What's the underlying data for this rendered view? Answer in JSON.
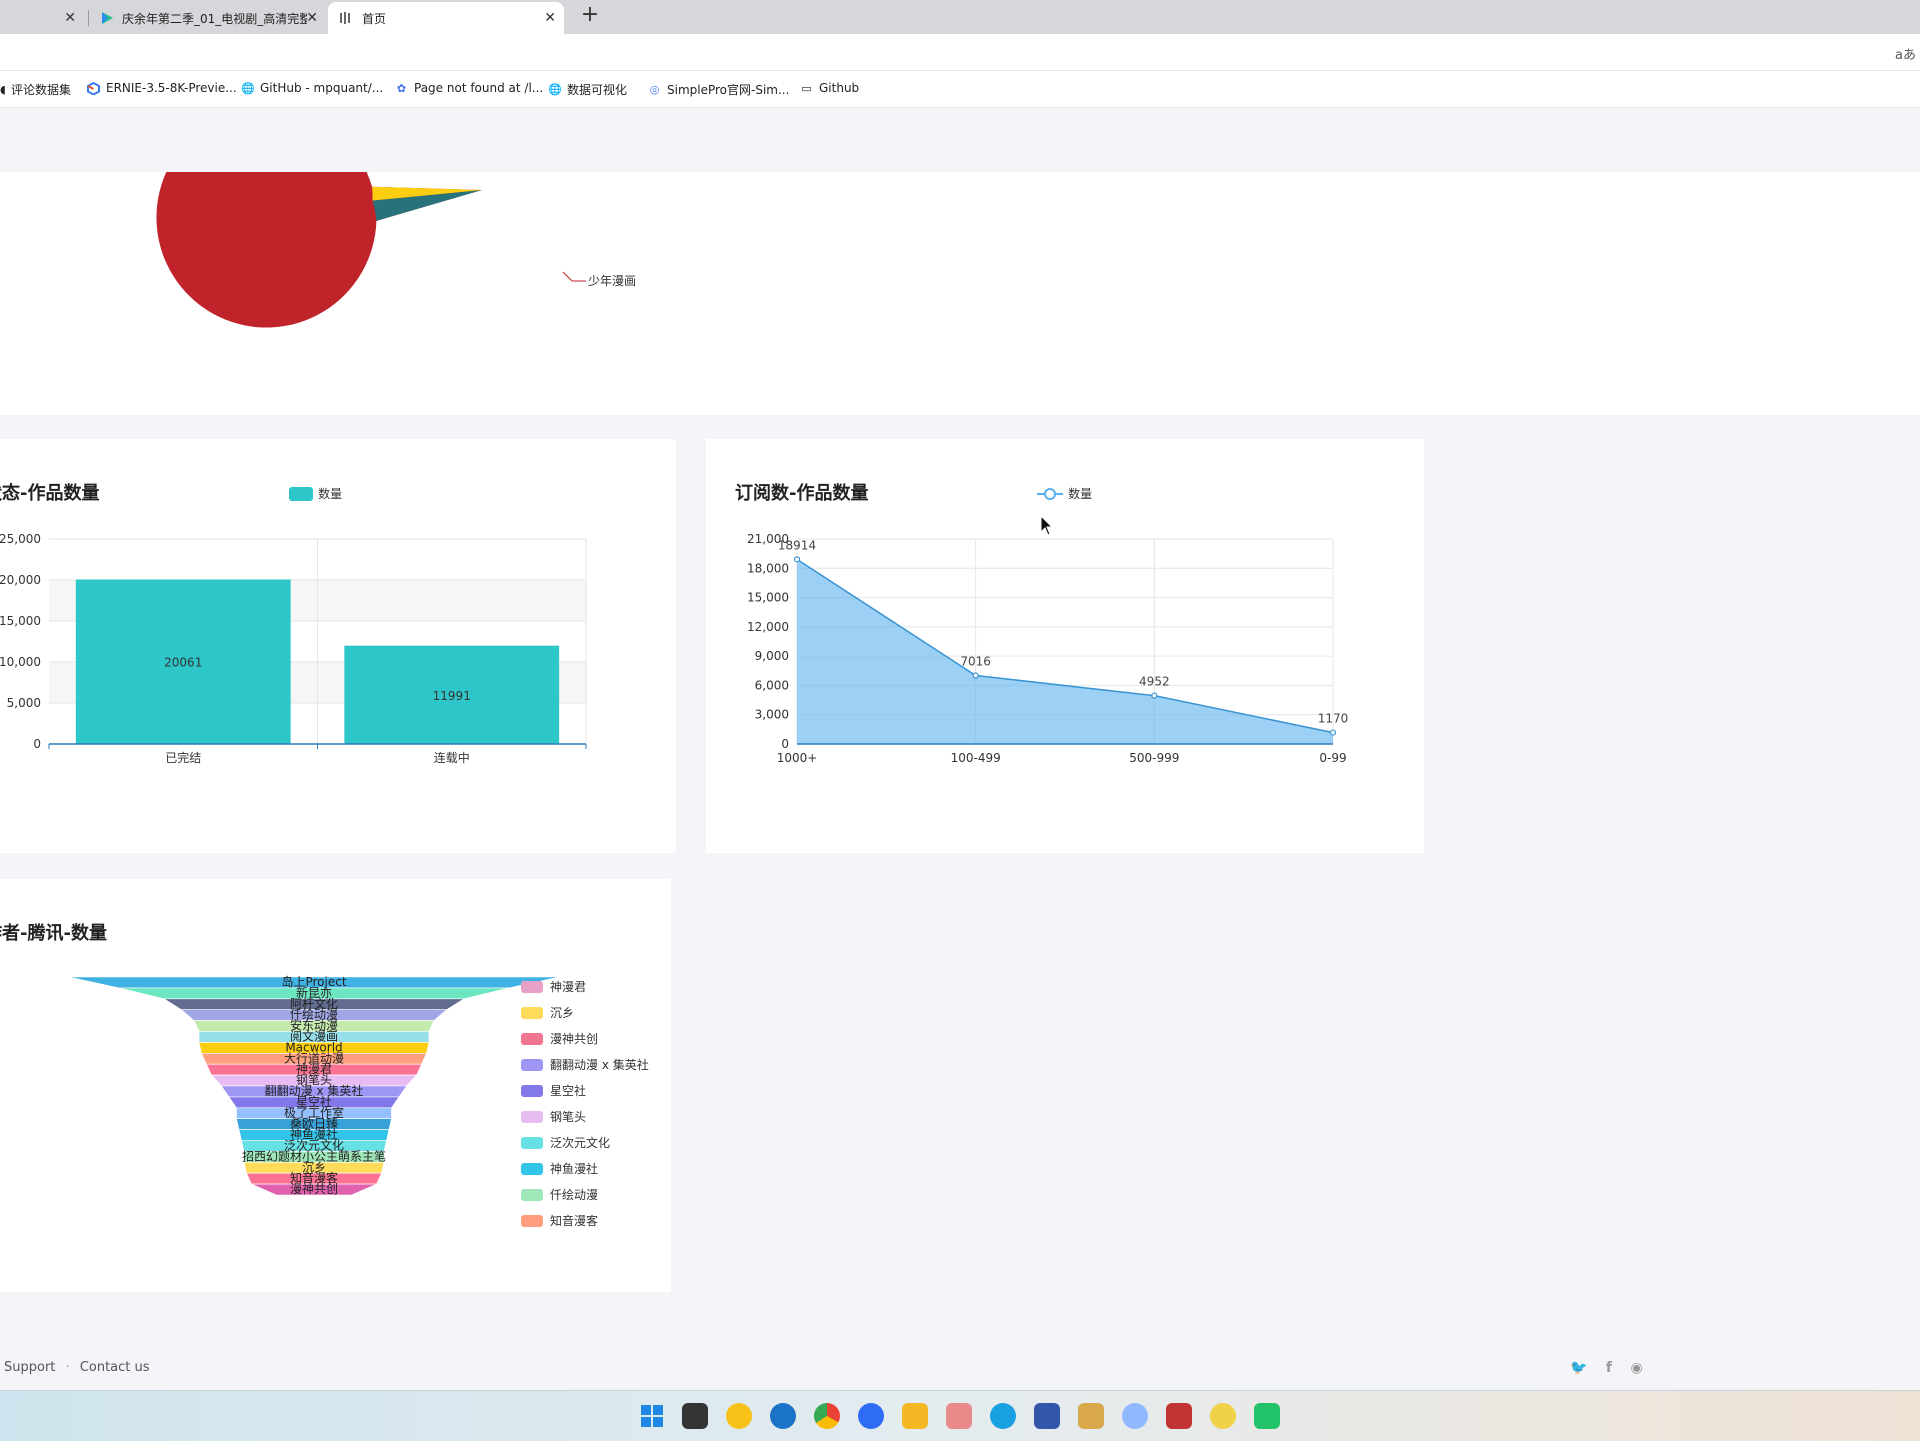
{
  "browser": {
    "tabs": [
      {
        "label": ""
      },
      {
        "label": "庆余年第二季_01_电视剧_高清完整"
      },
      {
        "label": "首页"
      }
    ],
    "new_tab_label": "+",
    "reader_mode_label": "aあ"
  },
  "bookmarks": [
    {
      "label": "评论数据集"
    },
    {
      "label": "ERNIE-3.5-8K-Previe..."
    },
    {
      "label": "GitHub - mpquant/..."
    },
    {
      "label": "Page not found at /l..."
    },
    {
      "label": "数据可视化"
    },
    {
      "label": "SimplePro官网-Sim..."
    },
    {
      "label": "Github"
    }
  ],
  "pie_card": {
    "label": "少年漫画",
    "chart_data": {
      "type": "pie",
      "slices": [
        {
          "name": "少年漫画",
          "value": 95,
          "color": "#c1232b"
        },
        {
          "name": "",
          "value": 3,
          "color": "#27727b"
        },
        {
          "name": "",
          "value": 2,
          "color": "#fcce10"
        }
      ]
    }
  },
  "status_card": {
    "title": "状态-作品数量",
    "legend": "数量",
    "chart_data": {
      "type": "bar",
      "categories": [
        "已完结",
        "连载中"
      ],
      "values": [
        20061,
        11991
      ],
      "ylim": [
        0,
        25000
      ],
      "yticks": [
        "0",
        "5,000",
        "10,000",
        "15,000",
        "20,000",
        "25,000"
      ],
      "color": "#2ec7c9",
      "data_labels": [
        "20061",
        "11991"
      ]
    }
  },
  "subs_card": {
    "title": "订阅数-作品数量",
    "legend": "数量",
    "chart_data": {
      "type": "area",
      "categories": [
        "1000+",
        "100-499",
        "500-999",
        "0-99"
      ],
      "values": [
        18914,
        7016,
        4952,
        1170
      ],
      "ylim": [
        0,
        21000
      ],
      "yticks": [
        "0",
        "3,000",
        "6,000",
        "9,000",
        "12,000",
        "15,000",
        "18,000",
        "21,000"
      ],
      "color": "#5ab1ef",
      "data_labels": [
        "18914",
        "7016",
        "4952",
        "1170"
      ]
    }
  },
  "author_card": {
    "title": "作者-腾讯-数量",
    "chart_data": {
      "type": "funnel",
      "labels": [
        "岛上Project",
        "新昆亦",
        "阿杆文化",
        "仟绘动漫",
        "安东动漫",
        "阅文漫画",
        "Macworld",
        "大行道动漫",
        "神漫君",
        "钢笔头",
        "翻翻动漫 x 集英社",
        "星空社",
        "极了工作室",
        "桑欧日臻",
        "神鱼漫社",
        "泛次元文化",
        "招西幻题材小公主萌系主笔",
        "沉乡",
        "知音漫客",
        "漫神共创"
      ],
      "colors": [
        "#3fb1e3",
        "#6be6c1",
        "#626c91",
        "#a0a7e6",
        "#c4ebad",
        "#96dee8",
        "#fcce10",
        "#ff9f7f",
        "#fb7293",
        "#e7bcf3",
        "#9d96f5",
        "#8378ea",
        "#96bfff",
        "#37a2da",
        "#32c5e9",
        "#67e0e3",
        "#9fe6b8",
        "#ffdb5c",
        "#fb7293",
        "#e062ae"
      ]
    },
    "legend": [
      {
        "label": "神漫君",
        "color": "#e7a0c7"
      },
      {
        "label": "沉乡",
        "color": "#ffdb5c"
      },
      {
        "label": "漫神共创",
        "color": "#f07590"
      },
      {
        "label": "翻翻动漫 x 集英社",
        "color": "#9d96f5"
      },
      {
        "label": "星空社",
        "color": "#8378ea"
      },
      {
        "label": "钢笔头",
        "color": "#e7bcf3"
      },
      {
        "label": "泛次元文化",
        "color": "#67e0e3"
      },
      {
        "label": "神鱼漫社",
        "color": "#32c5e9"
      },
      {
        "label": "仟绘动漫",
        "color": "#9fe6b8"
      },
      {
        "label": "知音漫客",
        "color": "#ff9f7f"
      }
    ]
  },
  "footer": {
    "support": "Support",
    "separator": "·",
    "contact": "Contact us"
  }
}
